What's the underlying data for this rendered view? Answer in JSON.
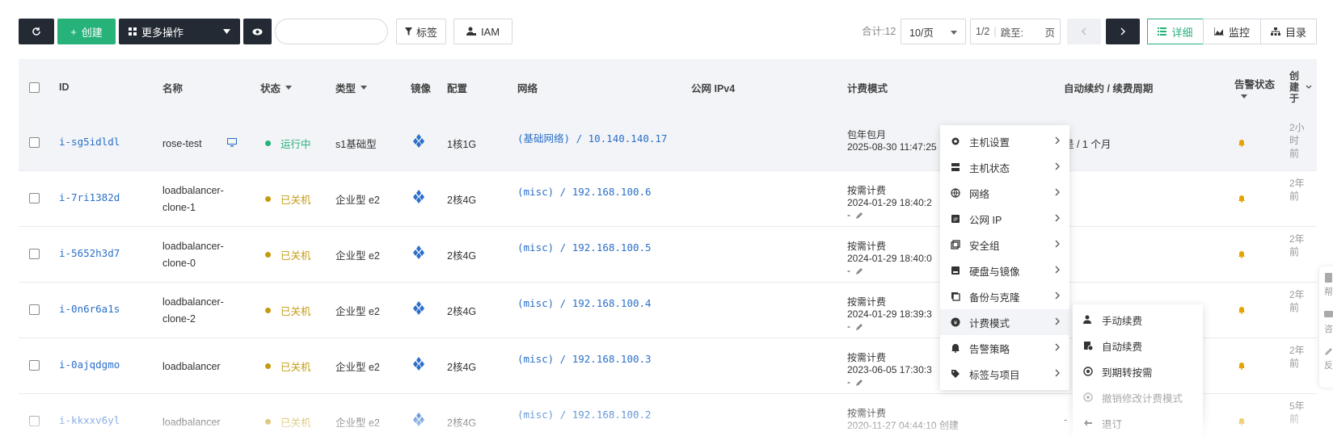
{
  "toolbar": {
    "create_label": "创建",
    "more_actions_label": "更多操作",
    "tag_label": "标签",
    "iam_label": "IAM",
    "search_placeholder": ""
  },
  "pager": {
    "total": "合计:12",
    "page_size": "10/页",
    "page_info": "1/2",
    "jump_label": "跳至:",
    "page_unit": "页"
  },
  "views": {
    "detail": "详细",
    "monitor": "监控",
    "catalog": "目录"
  },
  "columns": {
    "id": "ID",
    "name": "名称",
    "status": "状态",
    "type": "类型",
    "image": "镜像",
    "config": "配置",
    "network": "网络",
    "public_ip": "公网 IPv4",
    "billing": "计费模式",
    "renew": "自动续约 / 续费周期",
    "alert": "告警状态",
    "created": "创建于"
  },
  "rows": [
    {
      "id": "i-sg5idldl",
      "name1": "rose-test",
      "name2": "",
      "status": "运行中",
      "type": "s1基础型",
      "config": "1核1G",
      "network": "(基础网络) / 10.140.140.17",
      "billing1": "包年包月",
      "billing2": "2025-08-30 11:47:25",
      "billing3": "",
      "renew": "是 / 1 个月",
      "created": "2小时前"
    },
    {
      "id": "i-7ri1382d",
      "name1": "loadbalancer-",
      "name2": "clone-1",
      "status": "已关机",
      "type": "企业型 e2",
      "config": "2核4G",
      "network": "(misc) / 192.168.100.6",
      "billing1": "按需计费",
      "billing2": "2024-01-29 18:40:2",
      "billing3": "-",
      "renew": "",
      "created": "2年前"
    },
    {
      "id": "i-5652h3d7",
      "name1": "loadbalancer-",
      "name2": "clone-0",
      "status": "已关机",
      "type": "企业型 e2",
      "config": "2核4G",
      "network": "(misc) / 192.168.100.5",
      "billing1": "按需计费",
      "billing2": "2024-01-29 18:40:0",
      "billing3": "-",
      "renew": "",
      "created": "2年前"
    },
    {
      "id": "i-0n6r6a1s",
      "name1": "loadbalancer-",
      "name2": "clone-2",
      "status": "已关机",
      "type": "企业型 e2",
      "config": "2核4G",
      "network": "(misc) / 192.168.100.4",
      "billing1": "按需计费",
      "billing2": "2024-01-29 18:39:3",
      "billing3": "-",
      "renew": "",
      "created": "2年前"
    },
    {
      "id": "i-0ajqdgmo",
      "name1": "loadbalancer",
      "name2": "",
      "status": "已关机",
      "type": "企业型 e2",
      "config": "2核4G",
      "network": "(misc) / 192.168.100.3",
      "billing1": "按需计费",
      "billing2": "2023-06-05 17:30:3",
      "billing3": "-",
      "renew": "",
      "created": "2年前"
    },
    {
      "id": "i-kkxxv6yl",
      "name1": "loadbalancer",
      "name2": "",
      "status": "已关机",
      "type": "企业型 e2",
      "config": "2核4G",
      "network": "(misc) / 192.168.100.2",
      "billing1": "按需计费",
      "billing2": "2020-11-27 04:44:10 创建",
      "billing3": "",
      "renew": "-",
      "created": "5年前"
    }
  ],
  "menu": [
    {
      "label": "主机设置",
      "icon": "gear-icon"
    },
    {
      "label": "主机状态",
      "icon": "server-icon"
    },
    {
      "label": "网络",
      "icon": "globe-icon"
    },
    {
      "label": "公网 IP",
      "icon": "ip-icon"
    },
    {
      "label": "安全组",
      "icon": "security-group-icon"
    },
    {
      "label": "硬盘与镜像",
      "icon": "disk-icon"
    },
    {
      "label": "备份与克隆",
      "icon": "copy-icon"
    },
    {
      "label": "计费模式",
      "icon": "billing-icon"
    },
    {
      "label": "告警策略",
      "icon": "bell-icon"
    },
    {
      "label": "标签与项目",
      "icon": "tag-icon"
    }
  ],
  "submenu": [
    {
      "label": "手动续费",
      "icon": "user-renew-icon",
      "disabled": false
    },
    {
      "label": "自动续费",
      "icon": "auto-renew-icon",
      "disabled": false
    },
    {
      "label": "到期转按需",
      "icon": "convert-icon",
      "disabled": false
    },
    {
      "label": "撤销修改计费模式",
      "icon": "revoke-icon",
      "disabled": true
    },
    {
      "label": "退订",
      "icon": "return-icon",
      "disabled": false
    }
  ],
  "float_help": {
    "help": "帮",
    "consult": "咨",
    "feedback": "反"
  },
  "colors": {
    "accent": "#27b27a",
    "dark": "#232a33",
    "link": "#2a6fc9",
    "stopped": "#c49a0f"
  }
}
